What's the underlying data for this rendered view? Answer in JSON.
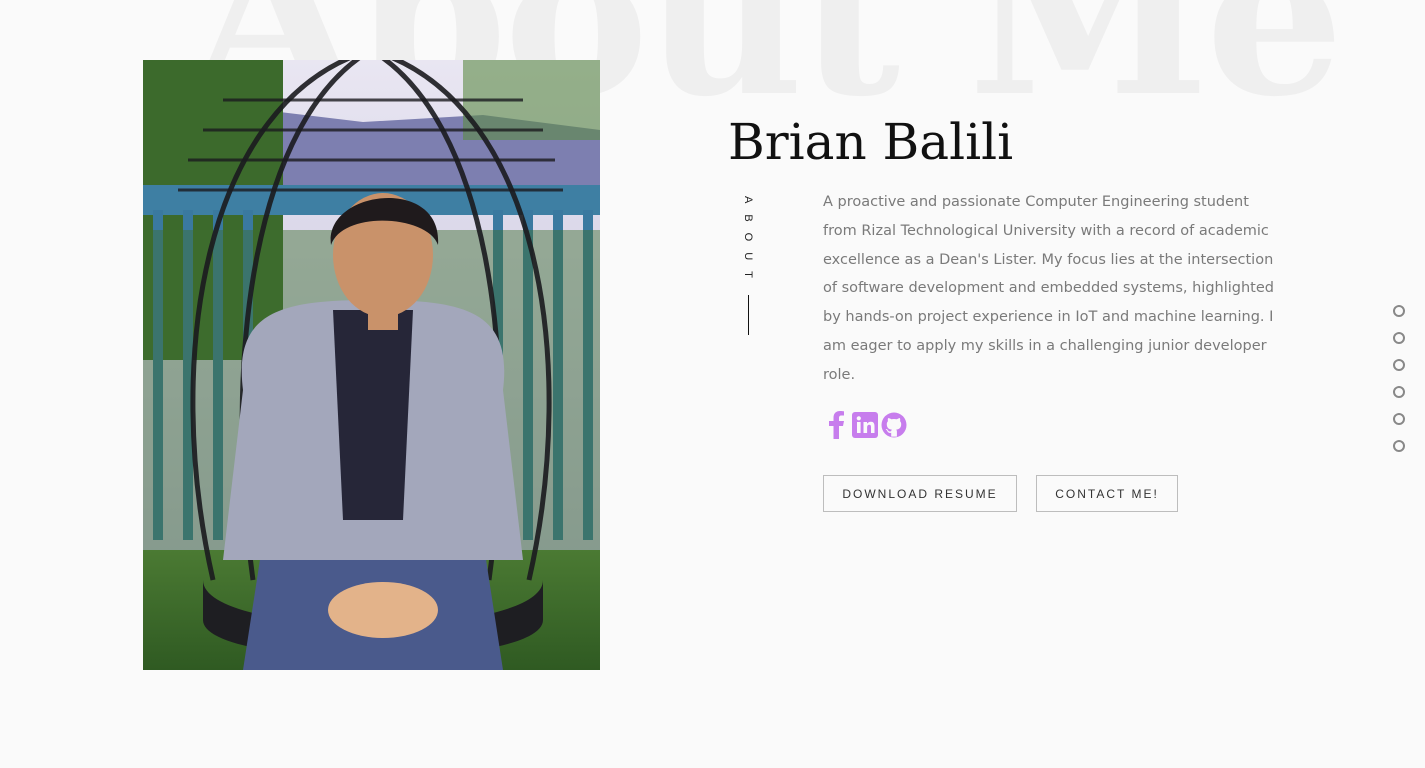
{
  "background_title": "About Me",
  "profile": {
    "name": "Brian Balili",
    "section_label": "ABOUT",
    "bio": "A proactive and passionate Computer Engineering student from Rizal Technological University with a record of academic excellence as a Dean's Lister. My focus lies at the intersection of software development and embedded systems, highlighted by hands-on project experience in IoT and machine learning. I am eager to apply my skills in a challenging junior developer role."
  },
  "socials": [
    {
      "icon": "facebook-icon"
    },
    {
      "icon": "linkedin-icon"
    },
    {
      "icon": "github-icon"
    }
  ],
  "buttons": {
    "resume_label": "DOWNLOAD RESUME",
    "contact_label": "CONTACT ME!"
  },
  "nav_dots_count": 6,
  "colors": {
    "accent": "#c77ded",
    "background": "#fafafa",
    "watermark": "#efefef"
  }
}
